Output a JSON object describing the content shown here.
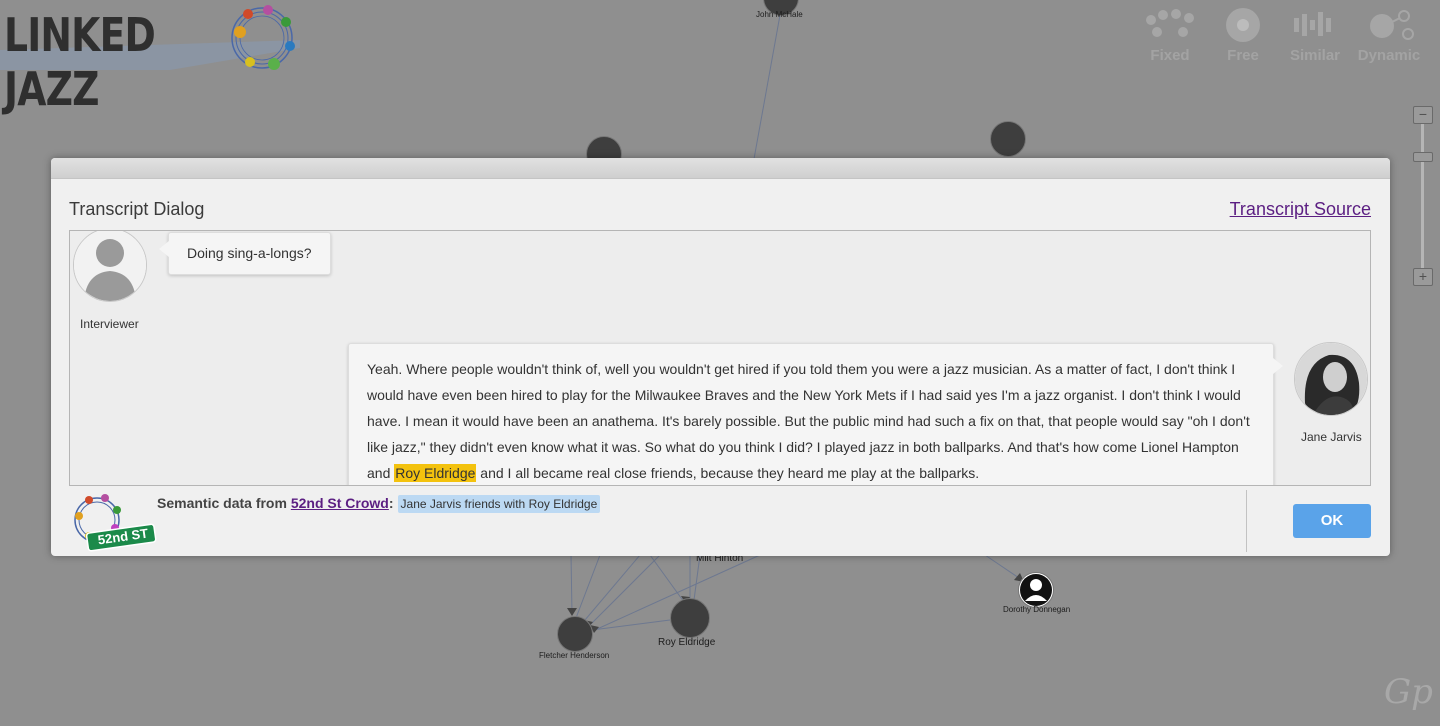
{
  "app": {
    "logo_text": "LINKED JAZZ"
  },
  "view_modes": [
    {
      "label": "Fixed",
      "icon": "fixed-layout-icon"
    },
    {
      "label": "Free",
      "icon": "free-layout-icon"
    },
    {
      "label": "Similar",
      "icon": "similar-layout-icon"
    },
    {
      "label": "Dynamic",
      "icon": "dynamic-layout-icon"
    }
  ],
  "zoom": {
    "minus": "−",
    "plus": "+"
  },
  "graph_nodes": [
    {
      "label": "John McHale"
    },
    {
      "label": "Milt Hinton"
    },
    {
      "label": "Fletcher Henderson"
    },
    {
      "label": "Roy Eldridge"
    },
    {
      "label": "Dorothy Donnegan"
    }
  ],
  "dialog": {
    "title": "Transcript Dialog",
    "source_link": "Transcript Source",
    "question": {
      "speaker": "Interviewer",
      "text": "Doing sing-a-longs?"
    },
    "answer": {
      "speaker": "Jane Jarvis",
      "text_before": "Yeah. Where people wouldn't think of, well you wouldn't get hired if you told them you were a jazz musician. As a matter of fact, I don't think I would have even been hired to play for the Milwaukee Braves and the New York Mets if I had said yes I'm a jazz organist. I don't think I would have. I mean it would have been an anathema. It's barely possible. But the public mind had such a fix on that, that people would say \"oh I don't like jazz,\" they didn't even know what it was. So what do you think I did? I played jazz in both ballparks. And that's how come Lionel Hampton and ",
      "highlight": "Roy Eldridge",
      "text_after": " and I all became real close friends, because they heard me play at the ballparks."
    },
    "semantic": {
      "prefix": "Semantic data from ",
      "source": "52nd St Crowd",
      "colon": ":",
      "relation": "Jane Jarvis friends with Roy Eldridge"
    },
    "badge_text": "52nd ST",
    "ok_label": "OK"
  },
  "watermark": "Gp",
  "colors": {
    "accent": "#5aa3e9",
    "link": "#5b1e82",
    "highlight": "#f3c20e",
    "chip": "#bcd9f3",
    "badge_green": "#1b8a4a"
  }
}
